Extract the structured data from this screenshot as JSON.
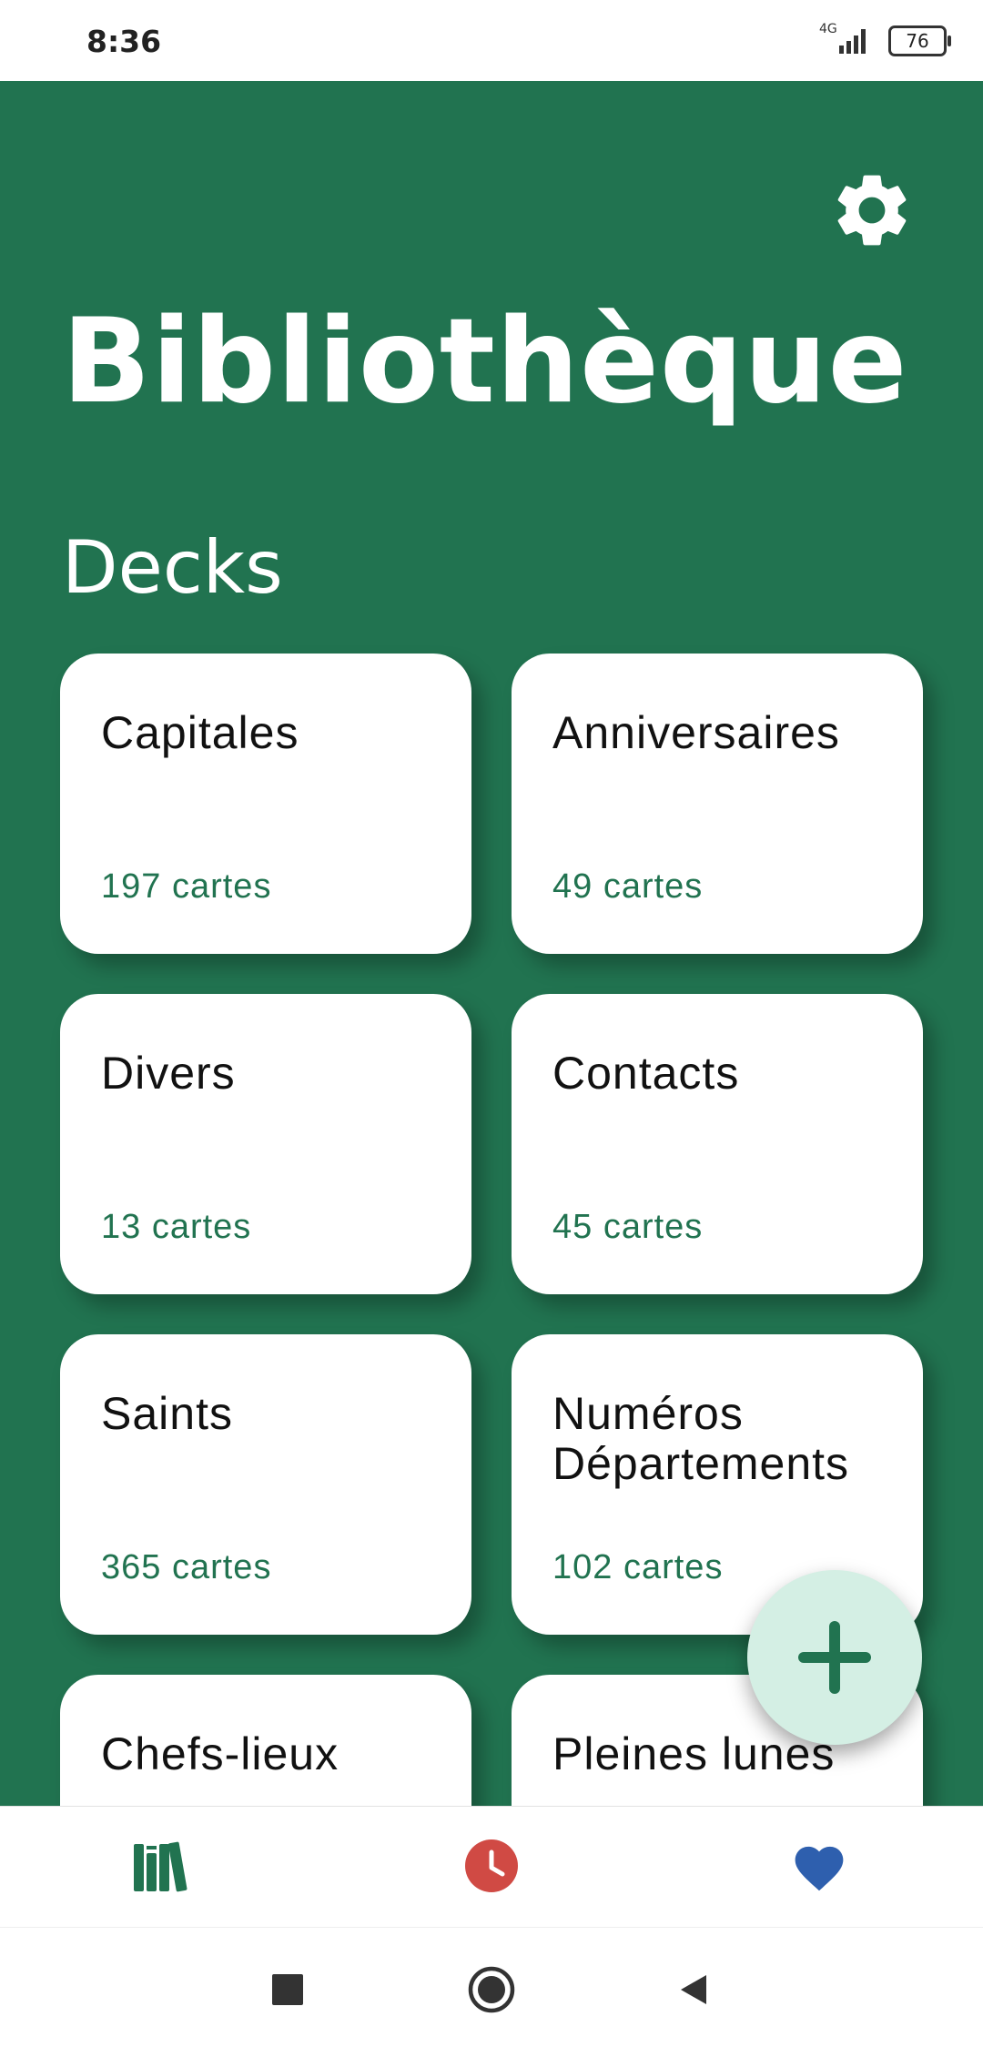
{
  "status_bar": {
    "time": "8:36",
    "network": "4G",
    "battery": "76"
  },
  "header": {
    "title": "Bibliothèque",
    "settings_icon": "gear-icon"
  },
  "section": {
    "title": "Decks"
  },
  "decks": [
    {
      "name": "Capitales",
      "count": "197 cartes"
    },
    {
      "name": "Anniversaires",
      "count": "49 cartes"
    },
    {
      "name": "Divers",
      "count": "13 cartes"
    },
    {
      "name": "Contacts",
      "count": "45 cartes"
    },
    {
      "name": "Saints",
      "count": "365 cartes"
    },
    {
      "name": "Numéros Départements",
      "count": "102 cartes"
    },
    {
      "name": "Chefs-lieux",
      "count": ""
    },
    {
      "name": "Pleines lunes",
      "count": ""
    }
  ],
  "fab": {
    "icon": "plus-icon"
  },
  "tabs": [
    {
      "icon": "library-icon",
      "color": "#217350"
    },
    {
      "icon": "clock-icon",
      "color": "#d04a44"
    },
    {
      "icon": "heart-icon",
      "color": "#2e5fae"
    }
  ],
  "colors": {
    "primary": "#217350",
    "fab_bg": "#d4efe4",
    "card_bg": "#ffffff"
  }
}
